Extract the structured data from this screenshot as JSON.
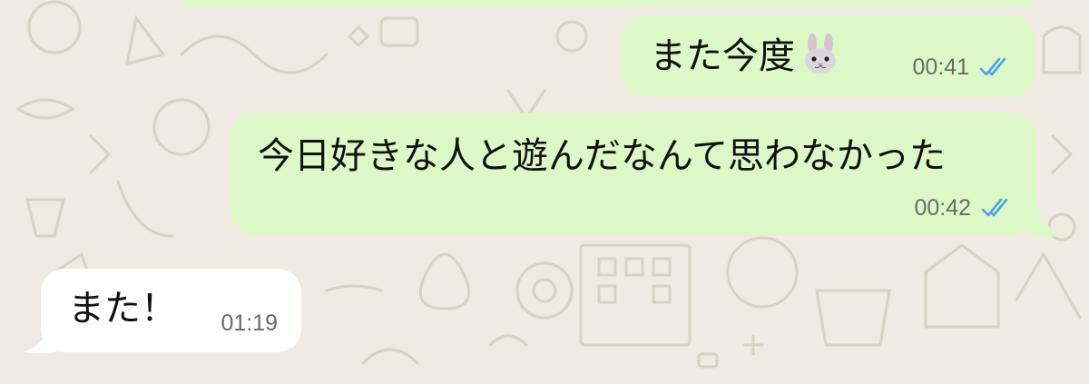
{
  "theme": {
    "outgoing_bubble": "#dcf8c6",
    "incoming_bubble": "#ffffff",
    "wallpaper": "#efeae2",
    "read_tick": "#4aa3f0"
  },
  "messages": [
    {
      "direction": "outgoing",
      "text": "また今度",
      "emoji": "rabbit-face-icon",
      "time": "00:41",
      "status": "read"
    },
    {
      "direction": "outgoing",
      "text": "今日好きな人と遊んだなんて思わなかった",
      "time": "00:42",
      "status": "read"
    },
    {
      "direction": "incoming",
      "text": "また！",
      "time": "01:19"
    }
  ]
}
